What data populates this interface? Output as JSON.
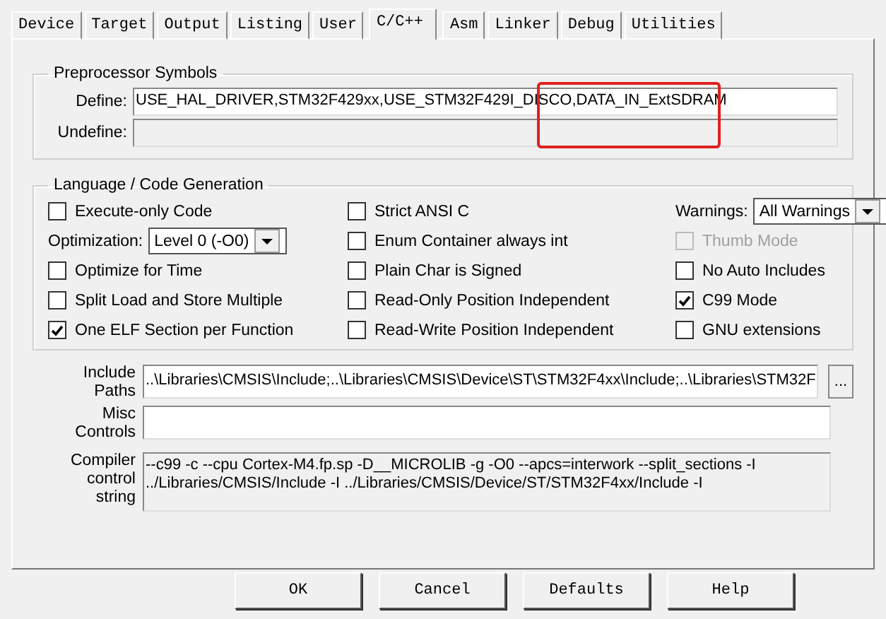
{
  "tabs": [
    {
      "label": "Device",
      "selected": false
    },
    {
      "label": "Target",
      "selected": false
    },
    {
      "label": "Output",
      "selected": false
    },
    {
      "label": "Listing",
      "selected": false
    },
    {
      "label": "User",
      "selected": false
    },
    {
      "label": "C/C++",
      "selected": true
    },
    {
      "label": "Asm",
      "selected": false
    },
    {
      "label": "Linker",
      "selected": false
    },
    {
      "label": "Debug",
      "selected": false
    },
    {
      "label": "Utilities",
      "selected": false
    }
  ],
  "preprocessor": {
    "title": "Preprocessor Symbols",
    "define": {
      "label": "Define:",
      "value": "USE_HAL_DRIVER,STM32F429xx,USE_STM32F429I_DISCO,DATA_IN_ExtSDRAM",
      "highlighted": true
    },
    "undefine": {
      "label": "Undefine:"
    }
  },
  "language": {
    "title": "Language / Code Generation",
    "columns": [
      [
        {
          "kind": "checkbox",
          "label": "Execute-only Code",
          "checked": false,
          "disabled": false
        },
        {
          "kind": "select",
          "label": "Optimization:",
          "value": "Level 0 (-O0)"
        },
        {
          "kind": "checkbox",
          "label": "Optimize for Time",
          "checked": false,
          "disabled": false
        },
        {
          "kind": "checkbox",
          "label": "Split Load and Store Multiple",
          "checked": false,
          "disabled": false
        },
        {
          "kind": "checkbox",
          "label": "One ELF Section per Function",
          "checked": true,
          "disabled": false
        }
      ],
      [
        {
          "kind": "checkbox",
          "label": "Strict ANSI C",
          "checked": false,
          "disabled": false
        },
        {
          "kind": "checkbox",
          "label": "Enum Container always int",
          "checked": false,
          "disabled": false
        },
        {
          "kind": "checkbox",
          "label": "Plain Char is Signed",
          "checked": false,
          "disabled": false
        },
        {
          "kind": "checkbox",
          "label": "Read-Only Position Independent",
          "checked": false,
          "disabled": false
        },
        {
          "kind": "checkbox",
          "label": "Read-Write Position Independent",
          "checked": false,
          "disabled": false
        }
      ],
      [
        {
          "kind": "select",
          "label": "Warnings:",
          "value": "All Warnings"
        },
        {
          "kind": "checkbox",
          "label": "Thumb Mode",
          "checked": false,
          "disabled": true
        },
        {
          "kind": "checkbox",
          "label": "No Auto Includes",
          "checked": false,
          "disabled": false
        },
        {
          "kind": "checkbox",
          "label": "C99 Mode",
          "checked": true,
          "disabled": false
        },
        {
          "kind": "checkbox",
          "label": "GNU extensions",
          "checked": false,
          "disabled": false
        }
      ]
    ]
  },
  "fields": [
    {
      "kind": "path",
      "label": [
        "Include",
        "Paths"
      ],
      "value": "..\\Libraries\\CMSIS\\Include;..\\Libraries\\CMSIS\\Device\\ST\\STM32F4xx\\Include;..\\Libraries\\STM32F",
      "button": "..."
    },
    {
      "kind": "text",
      "label": [
        "Misc",
        "Controls"
      ]
    },
    {
      "kind": "readonly",
      "label": [
        "Compiler",
        "control",
        "string"
      ],
      "lines": [
        "--c99 -c --cpu Cortex-M4.fp.sp -D__MICROLIB -g -O0 --apcs=interwork --split_sections -I",
        "../Libraries/CMSIS/Include -I ../Libraries/CMSIS/Device/ST/STM32F4xx/Include -I"
      ]
    }
  ],
  "buttons": [
    {
      "label": "OK"
    },
    {
      "label": "Cancel"
    },
    {
      "label": "Defaults"
    },
    {
      "label": "Help"
    }
  ]
}
